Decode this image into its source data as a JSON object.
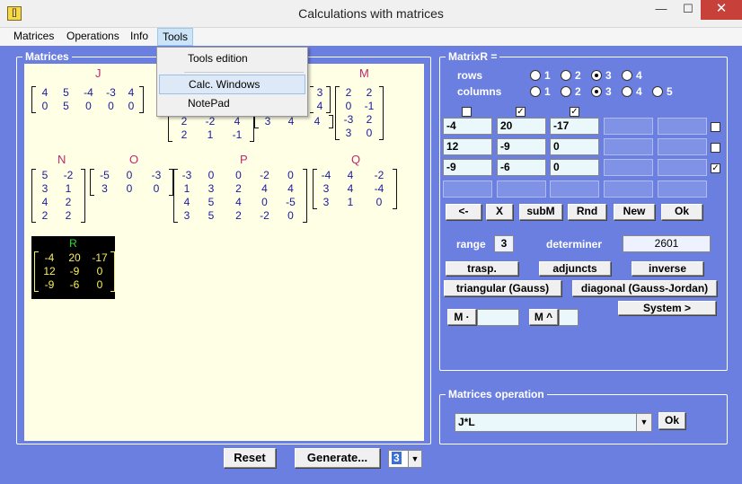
{
  "window": {
    "title": "Calculations with matrices",
    "minimize": "—",
    "maximize": "☐",
    "close": "✕",
    "icon": "matrix-app-icon"
  },
  "menu": [
    "Matrices",
    "Operations",
    "Info",
    "Tools"
  ],
  "tools_menu": [
    "Tools edition",
    "Calc. Windows",
    "NotePad"
  ],
  "matrices_group": {
    "label": "Matrices"
  },
  "matrices": {
    "J": {
      "name": "J",
      "rows": [
        [
          "4",
          "5",
          "-4",
          "-3",
          "4"
        ],
        [
          "0",
          "5",
          "0",
          "0",
          "0"
        ]
      ]
    },
    "K_partial": {
      "rows": [
        [
          "",
          "",
          "3"
        ],
        [
          "2",
          "-2",
          "4"
        ],
        [
          "2",
          "1",
          "-1"
        ]
      ]
    },
    "L_partial": {
      "rows": [
        [
          "3",
          "4",
          "4"
        ]
      ]
    },
    "Lcol": {
      "rows": [
        [
          "3"
        ],
        [
          "4"
        ]
      ]
    },
    "M": {
      "name": "M",
      "rows": [
        [
          "2",
          "2"
        ],
        [
          "0",
          "-1"
        ],
        [
          "-3",
          "2"
        ],
        [
          "3",
          "0"
        ]
      ]
    },
    "N": {
      "name": "N",
      "rows": [
        [
          "5",
          "-2"
        ],
        [
          "3",
          "1"
        ],
        [
          "4",
          "2"
        ],
        [
          "2",
          "2"
        ]
      ]
    },
    "O": {
      "name": "O",
      "rows": [
        [
          "-5",
          "0",
          "-3"
        ],
        [
          "3",
          "0",
          "0"
        ]
      ]
    },
    "P": {
      "name": "P",
      "rows": [
        [
          "-3",
          "0",
          "0",
          "-2",
          "0"
        ],
        [
          "1",
          "3",
          "2",
          "4",
          "4"
        ],
        [
          "4",
          "5",
          "4",
          "0",
          "-5"
        ],
        [
          "3",
          "5",
          "2",
          "-2",
          "0"
        ]
      ]
    },
    "Q": {
      "name": "Q",
      "rows": [
        [
          "-4",
          "4",
          "-2"
        ],
        [
          "3",
          "4",
          "-4"
        ],
        [
          "3",
          "1",
          "0"
        ]
      ]
    },
    "R": {
      "name": "R",
      "rows": [
        [
          "-4",
          "20",
          "-17"
        ],
        [
          "12",
          "-9",
          "0"
        ],
        [
          "-9",
          "-6",
          "0"
        ]
      ]
    }
  },
  "matrixR": {
    "label": "MatrixR =",
    "rows_label": "rows",
    "columns_label": "columns",
    "rows_options": [
      "1",
      "2",
      "3",
      "4"
    ],
    "rows_selected": "3",
    "columns_options": [
      "1",
      "2",
      "3",
      "4",
      "5"
    ],
    "columns_selected": "3",
    "grid": [
      [
        "-4",
        "20",
        "-17",
        "",
        ""
      ],
      [
        "12",
        "-9",
        "0",
        "",
        ""
      ],
      [
        "-9",
        "-6",
        "0",
        "",
        ""
      ],
      [
        "",
        "",
        "",
        "",
        ""
      ]
    ],
    "buttons": [
      "<-",
      "X",
      "subM",
      "Rnd",
      "New",
      "Ok"
    ],
    "range_label": "range",
    "range_value": "3",
    "determiner_label": "determiner",
    "determiner_value": "2601",
    "ops": [
      "trasp.",
      "adjuncts",
      "inverse",
      "triangular (Gauss)",
      "diagonal (Gauss-Jordan)",
      "System >"
    ],
    "mult_label": "M ·",
    "pow_label": "M ^"
  },
  "ops_group": {
    "label": "Matrices operation",
    "value": "J*L",
    "ok": "Ok"
  },
  "bottom": {
    "reset": "Reset",
    "generate": "Generate...",
    "count": "3"
  }
}
